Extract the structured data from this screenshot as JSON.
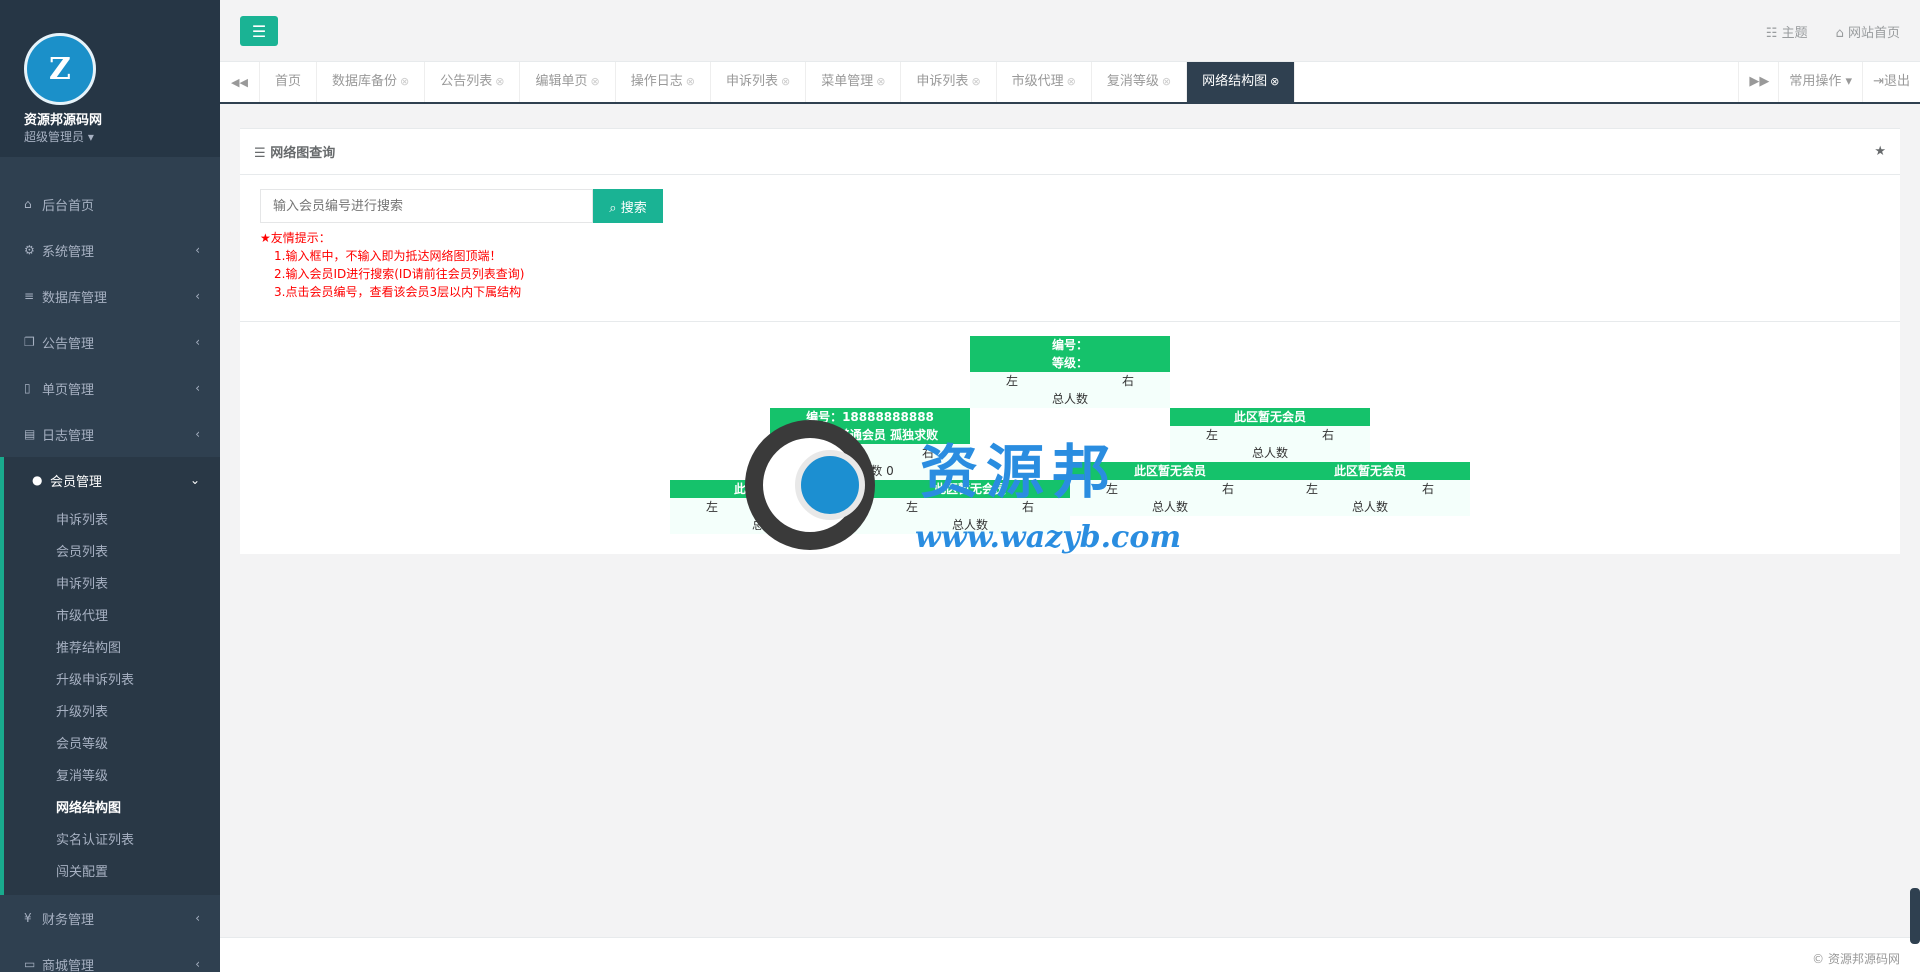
{
  "sidebar": {
    "site_name": "资源邦源码网",
    "role": "超级管理员",
    "items": [
      {
        "icon": "home-icon",
        "label": "后台首页"
      },
      {
        "icon": "gear-icon",
        "label": "系统管理"
      },
      {
        "icon": "database-icon",
        "label": "数据库管理"
      },
      {
        "icon": "copy-icon",
        "label": "公告管理"
      },
      {
        "icon": "file-icon",
        "label": "单页管理"
      },
      {
        "icon": "list-icon",
        "label": "日志管理"
      },
      {
        "icon": "user-icon",
        "label": "会员管理"
      }
    ],
    "sub_items": [
      "申诉列表",
      "会员列表",
      "申诉列表",
      "市级代理",
      "推荐结构图",
      "升级申诉列表",
      "升级列表",
      "会员等级",
      "复消等级",
      "网络结构图",
      "实名认证列表",
      "闯关配置"
    ],
    "bottom_items": [
      {
        "icon": "yen-icon",
        "label": "财务管理"
      },
      {
        "icon": "monitor-icon",
        "label": "商城管理"
      }
    ]
  },
  "topbar": {
    "theme": "主题",
    "home": "网站首页"
  },
  "tabs": [
    "首页",
    "数据库备份",
    "公告列表",
    "编辑单页",
    "操作日志",
    "申诉列表",
    "菜单管理",
    "申诉列表",
    "市级代理",
    "复消等级",
    "网络结构图"
  ],
  "tabs_right": {
    "ops": "常用操作",
    "logout": "退出"
  },
  "panel": {
    "title": "网络图查询",
    "search_placeholder": "输入会员编号进行搜索",
    "search_btn": "搜索",
    "tips_title": "★友情提示：",
    "tips": [
      "1.输入框中，不输入即为抵达网络图顶端！",
      "2.输入会员ID进行搜索(ID请前往会员列表查询)",
      "3.点击会员编号，查看该会员3层以内下属结构"
    ]
  },
  "tree": {
    "root": {
      "h1": "编号：",
      "h2": "等级：",
      "left": "左",
      "right": "右",
      "total": "总人数"
    },
    "l1": {
      "h1": "编号：18888888888",
      "h2": "等级：普通会员 孤独求败",
      "left": "左",
      "right": "右",
      "total": "总人数",
      "zero": "0"
    },
    "r1": {
      "h1": "此区暂无会员",
      "left": "左",
      "right": "右",
      "total": "总人数"
    },
    "ll": {
      "h1": "此区暂无会员",
      "left": "左",
      "right": "右",
      "total": "总人数"
    },
    "lr": {
      "h1": "此区暂无会员",
      "left": "左",
      "right": "右",
      "total": "总人数"
    },
    "rl": {
      "h1": "此区暂无会员",
      "left": "左",
      "right": "右",
      "total": "总人数"
    },
    "rr": {
      "h1": "此区暂无会员",
      "left": "左",
      "right": "右",
      "total": "总人数"
    }
  },
  "watermark": {
    "text": "资源邦",
    "url": "www.wazyb.com"
  },
  "footer": "© 资源邦源码网"
}
